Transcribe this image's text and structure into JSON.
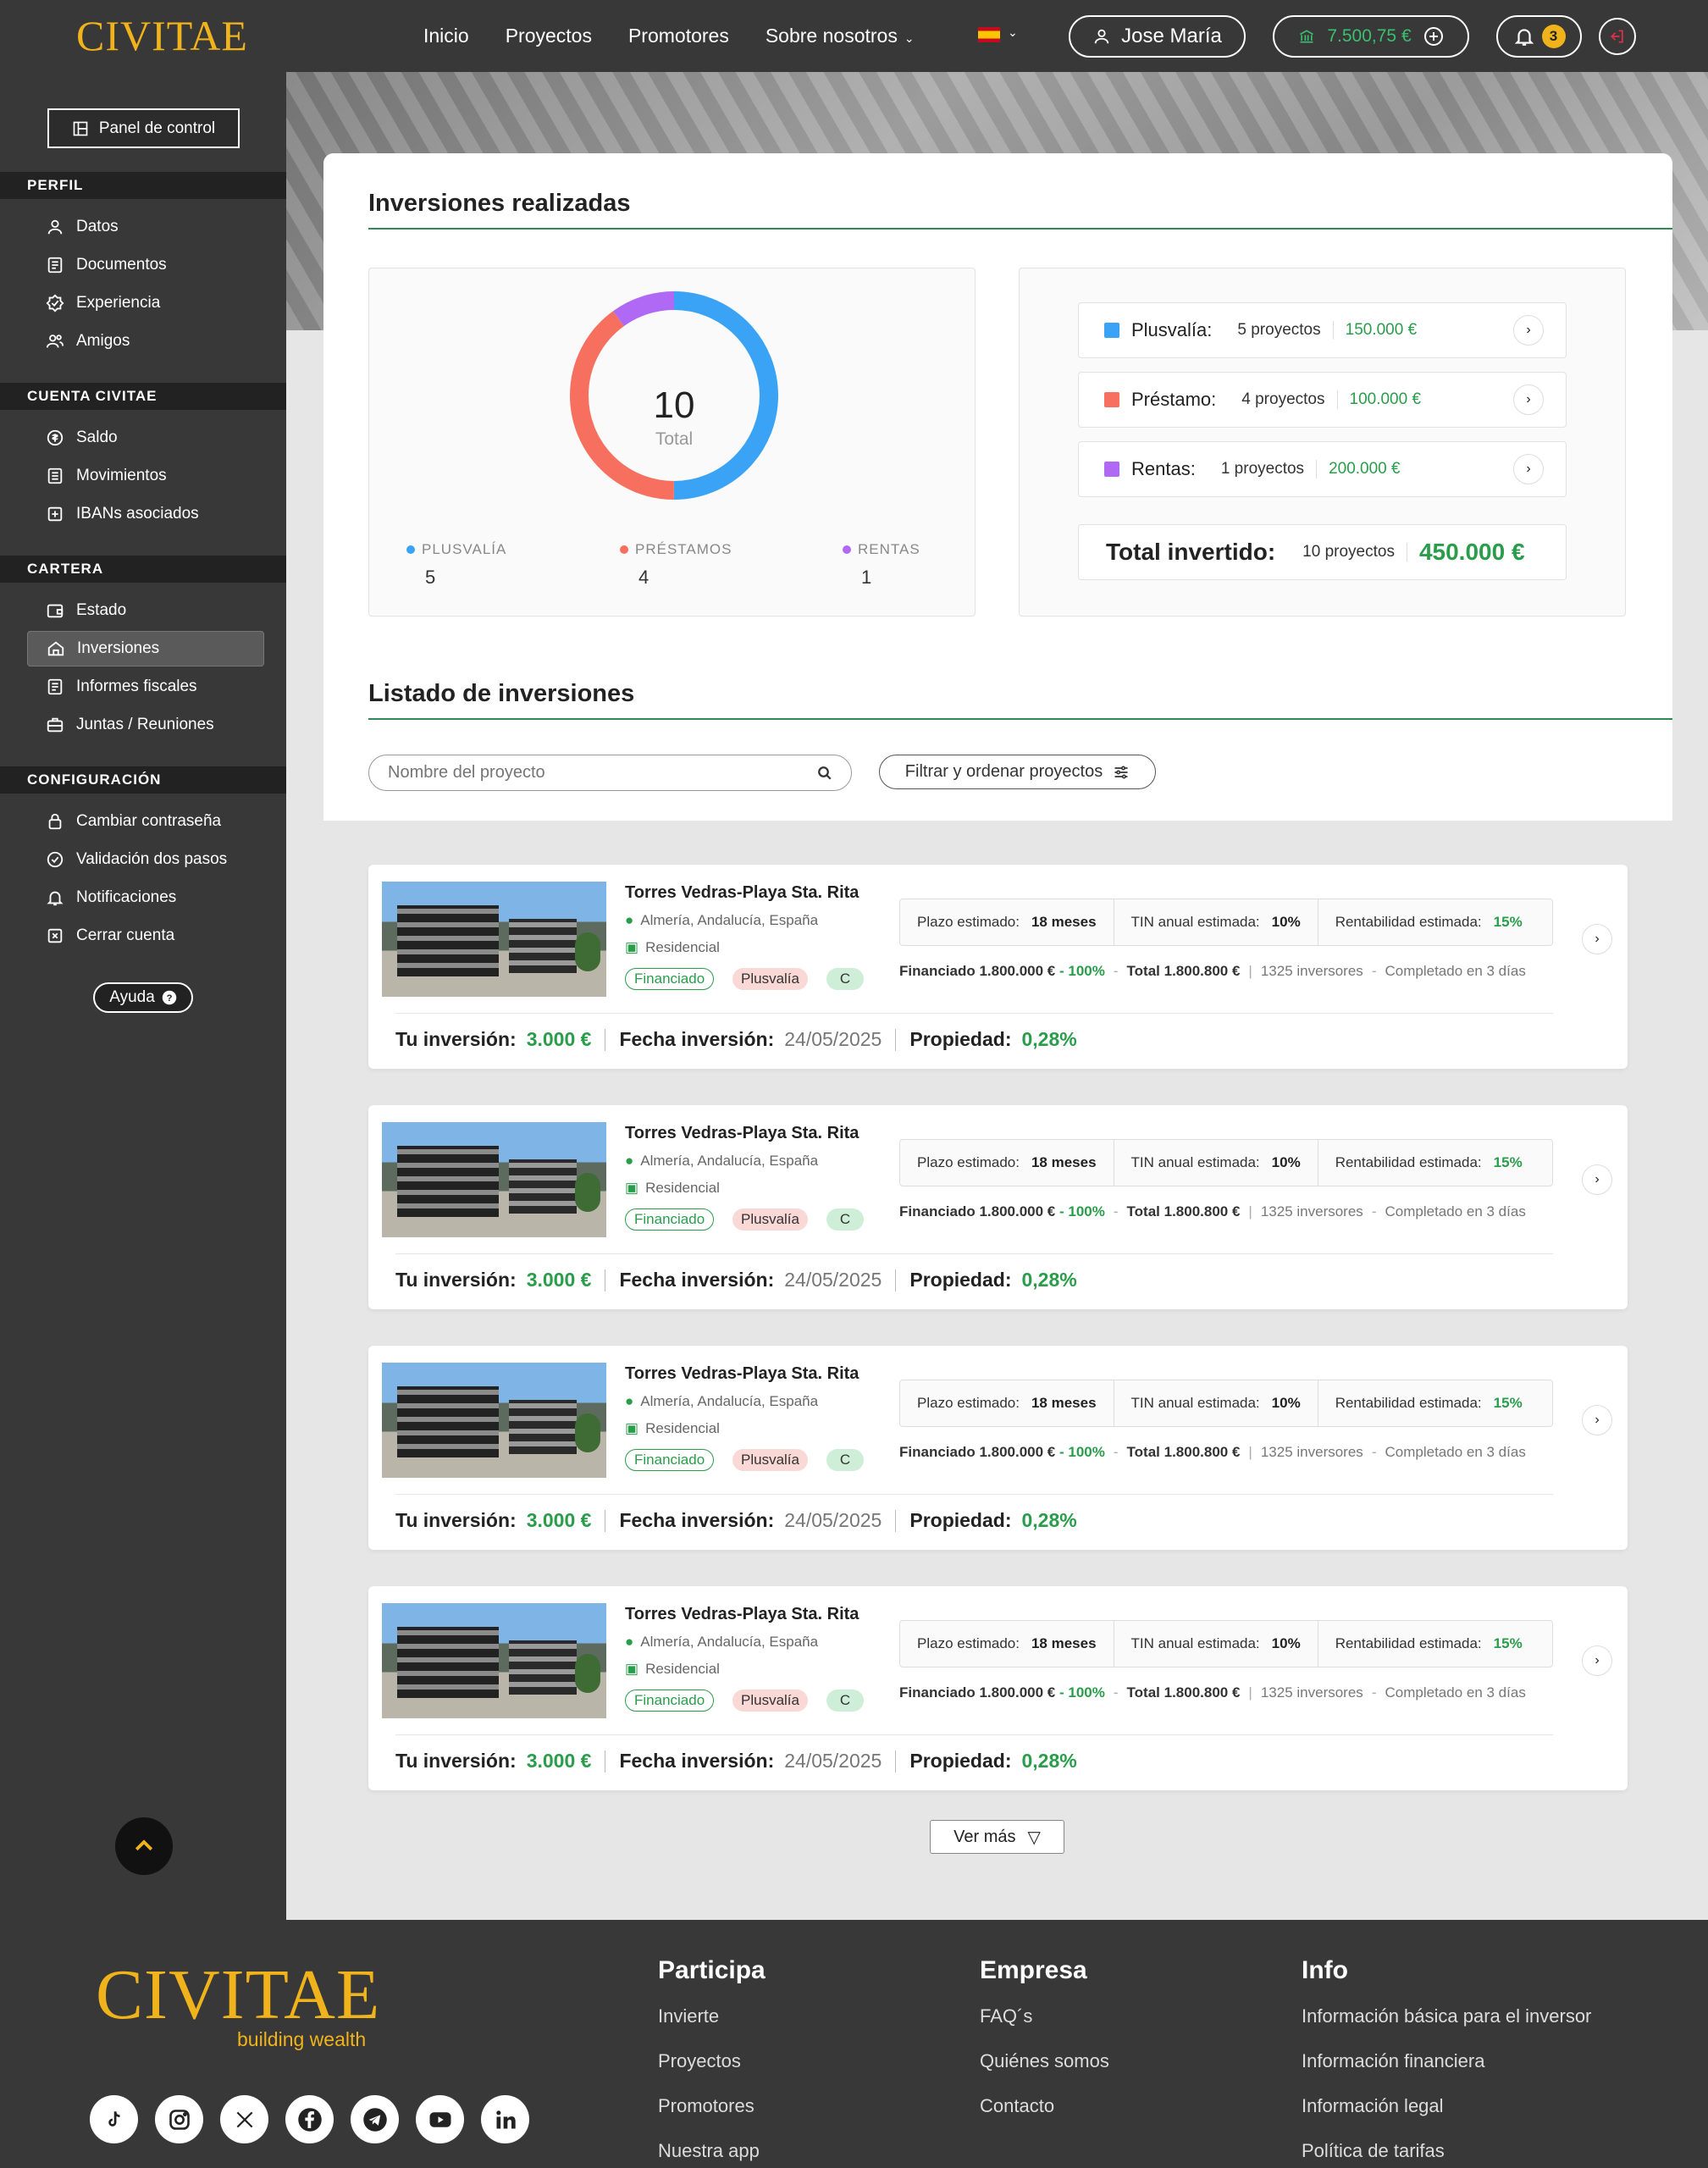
{
  "header": {
    "logo": "CIVITAE",
    "nav": [
      "Inicio",
      "Proyectos",
      "Promotores",
      "Sobre nosotros"
    ],
    "user_name": "Jose María",
    "balance": "7.500,75 €",
    "notifications": "3"
  },
  "sidebar": {
    "panel_button": "Panel de control",
    "sections": {
      "perfil": "PERFIL",
      "cuenta": "CUENTA CIVITAE",
      "cartera": "CARTERA",
      "config": "CONFIGURACIÓN"
    },
    "perfil_items": [
      "Datos",
      "Documentos",
      "Experiencia",
      "Amigos"
    ],
    "cuenta_items": [
      "Saldo",
      "Movimientos",
      "IBANs asociados"
    ],
    "cartera_items": [
      "Estado",
      "Inversiones",
      "Informes fiscales",
      "Juntas / Reuniones"
    ],
    "config_items": [
      "Cambiar contraseña",
      "Validación dos pasos",
      "Notificaciones",
      "Cerrar cuenta"
    ],
    "help": "Ayuda"
  },
  "summary": {
    "title": "Inversiones realizadas",
    "total_value": "10",
    "total_label": "Total",
    "legend": [
      {
        "label": "PLUSVALÍA",
        "value": "5",
        "color": "#3aa3f5"
      },
      {
        "label": "PRÉSTAMOS",
        "value": "4",
        "color": "#f76f5e"
      },
      {
        "label": "RENTAS",
        "value": "1",
        "color": "#b069f5"
      }
    ],
    "categories": [
      {
        "name": "Plusvalía:",
        "projects": "5 proyectos",
        "amount": "150.000 €",
        "color": "#3aa3f5"
      },
      {
        "name": "Préstamo:",
        "projects": "4 proyectos",
        "amount": "100.000 €",
        "color": "#f76f5e"
      },
      {
        "name": "Rentas:",
        "projects": "1 proyectos",
        "amount": "200.000 €",
        "color": "#b069f5"
      }
    ],
    "total_label_long": "Total invertido:",
    "total_projects": "10 proyectos",
    "total_amount": "450.000 €"
  },
  "listing": {
    "title": "Listado de inversiones",
    "search_placeholder": "Nombre del proyecto",
    "filter_label": "Filtrar y ordenar proyectos",
    "items": [
      {
        "title": "Torres Vedras-Playa Sta. Rita",
        "location": "Almería, Andalucía, España",
        "type": "Residencial",
        "tag1": "Financiado",
        "tag2": "Plusvalía",
        "tag3": "C",
        "plazo_label": "Plazo estimado:",
        "plazo": "18 meses",
        "tin_label": "TIN anual estimada:",
        "tin": "10%",
        "rent_label": "Rentabilidad estimada:",
        "rent": "15%",
        "financiado": "Financiado 1.800.000 €",
        "financiado_pct": "- 100%",
        "total": "Total 1.800.800 €",
        "inversores": "1325 inversores",
        "completado": "Completado en 3 días",
        "inv_label": "Tu inversión:",
        "inv_value": "3.000 €",
        "fecha_label": "Fecha inversión:",
        "fecha": "24/05/2025",
        "prop_label": "Propiedad:",
        "prop": "0,28%"
      },
      {
        "title": "Torres Vedras-Playa Sta. Rita",
        "location": "Almería, Andalucía, España",
        "type": "Residencial",
        "tag1": "Financiado",
        "tag2": "Plusvalía",
        "tag3": "C",
        "plazo_label": "Plazo estimado:",
        "plazo": "18 meses",
        "tin_label": "TIN anual estimada:",
        "tin": "10%",
        "rent_label": "Rentabilidad estimada:",
        "rent": "15%",
        "financiado": "Financiado 1.800.000 €",
        "financiado_pct": "- 100%",
        "total": "Total 1.800.800 €",
        "inversores": "1325 inversores",
        "completado": "Completado en 3 días",
        "inv_label": "Tu inversión:",
        "inv_value": "3.000 €",
        "fecha_label": "Fecha inversión:",
        "fecha": "24/05/2025",
        "prop_label": "Propiedad:",
        "prop": "0,28%"
      },
      {
        "title": "Torres Vedras-Playa Sta. Rita",
        "location": "Almería, Andalucía, España",
        "type": "Residencial",
        "tag1": "Financiado",
        "tag2": "Plusvalía",
        "tag3": "C",
        "plazo_label": "Plazo estimado:",
        "plazo": "18 meses",
        "tin_label": "TIN anual estimada:",
        "tin": "10%",
        "rent_label": "Rentabilidad estimada:",
        "rent": "15%",
        "financiado": "Financiado 1.800.000 €",
        "financiado_pct": "- 100%",
        "total": "Total 1.800.800 €",
        "inversores": "1325 inversores",
        "completado": "Completado en 3 días",
        "inv_label": "Tu inversión:",
        "inv_value": "3.000 €",
        "fecha_label": "Fecha inversión:",
        "fecha": "24/05/2025",
        "prop_label": "Propiedad:",
        "prop": "0,28%"
      },
      {
        "title": "Torres Vedras-Playa Sta. Rita",
        "location": "Almería, Andalucía, España",
        "type": "Residencial",
        "tag1": "Financiado",
        "tag2": "Plusvalía",
        "tag3": "C",
        "plazo_label": "Plazo estimado:",
        "plazo": "18 meses",
        "tin_label": "TIN anual estimada:",
        "tin": "10%",
        "rent_label": "Rentabilidad estimada:",
        "rent": "15%",
        "financiado": "Financiado 1.800.000 €",
        "financiado_pct": "- 100%",
        "total": "Total 1.800.800 €",
        "inversores": "1325 inversores",
        "completado": "Completado en 3 días",
        "inv_label": "Tu inversión:",
        "inv_value": "3.000 €",
        "fecha_label": "Fecha inversión:",
        "fecha": "24/05/2025",
        "prop_label": "Propiedad:",
        "prop": "0,28%"
      }
    ],
    "ver_mas": "Ver más"
  },
  "footer": {
    "logo": "CIVITAE",
    "tagline": "building wealth",
    "columns": [
      {
        "title": "Participa",
        "links": [
          "Invierte",
          "Proyectos",
          "Promotores",
          "Nuestra app"
        ]
      },
      {
        "title": "Empresa",
        "links": [
          "FAQ´s",
          "Quiénes somos",
          "Contacto"
        ]
      },
      {
        "title": "Info",
        "links": [
          "Información básica para el inversor",
          "Información financiera",
          "Información legal",
          "Política de tarifas"
        ]
      }
    ],
    "socials": [
      "tiktok-icon",
      "instagram-icon",
      "x-icon",
      "facebook-icon",
      "telegram-icon",
      "youtube-icon",
      "linkedin-icon"
    ]
  }
}
